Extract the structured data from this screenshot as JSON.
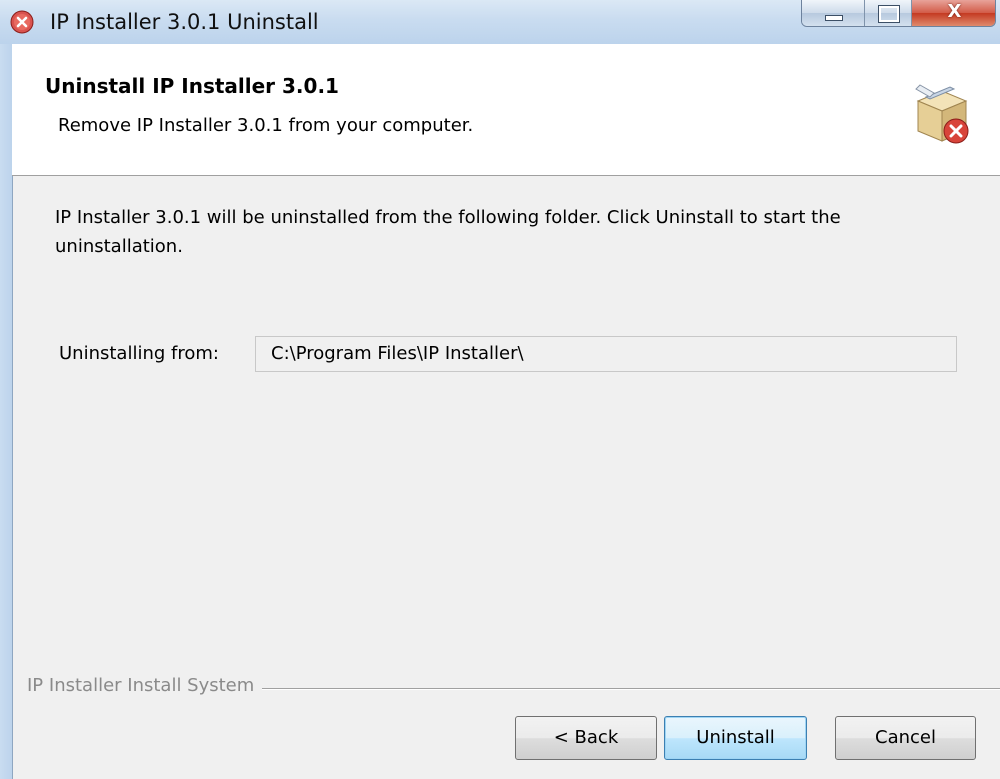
{
  "window": {
    "title": "IP Installer 3.0.1 Uninstall",
    "controls": {
      "minimize_icon": "minimize-icon",
      "maximize_icon": "maximize-icon",
      "close_glyph": "X"
    }
  },
  "header": {
    "title": "Uninstall IP Installer 3.0.1",
    "subtitle": "Remove IP Installer 3.0.1 from your computer.",
    "icon": "uninstall-box-icon"
  },
  "main": {
    "description": "IP Installer 3.0.1 will be uninstalled from the following folder. Click Uninstall to start the uninstallation.",
    "folder_label": "Uninstalling from:",
    "folder_value": "C:\\Program Files\\IP Installer\\"
  },
  "footer": {
    "branding": "IP Installer Install System",
    "back_label": "< Back",
    "uninstall_label": "Uninstall",
    "cancel_label": "Cancel"
  },
  "colors": {
    "titlebar": "#c9dcf0",
    "dialog_bg": "#f0f0f0",
    "close_button": "#c43a22",
    "default_button_border": "#3c7fb1"
  }
}
